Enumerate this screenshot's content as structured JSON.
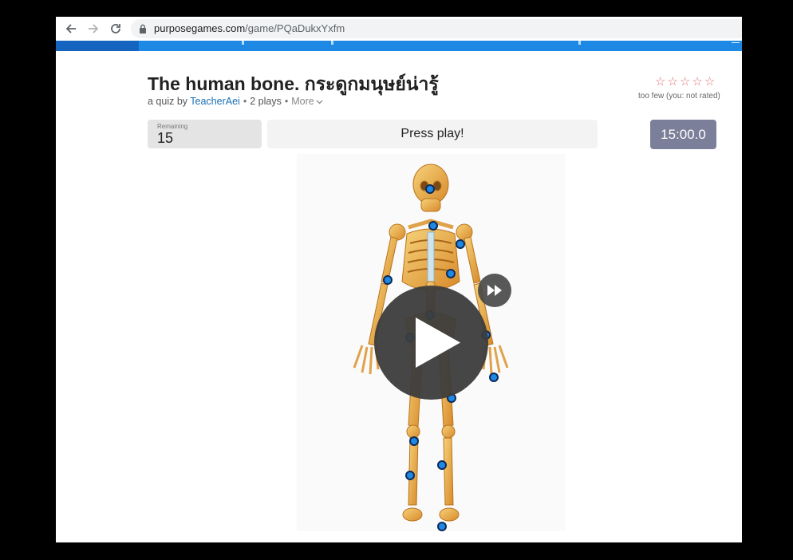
{
  "browser": {
    "url_host": "purposegames.com",
    "url_path": "/game/PQaDukxYxfm"
  },
  "quiz": {
    "title": "The human bone. กระดูกมนุษย์น่ารู้",
    "byline_prefix": "a quiz by",
    "author": "TeacherAei",
    "plays": "2 plays",
    "more": "More"
  },
  "rating": {
    "stars_filled": 0,
    "stars_total": 5,
    "note": "too few (you: not rated)"
  },
  "game": {
    "remaining_label": "Remaining",
    "remaining_value": "15",
    "press_play": "Press play!",
    "timer": "15:00.0"
  },
  "colors": {
    "accent_blue": "#1e88e5",
    "timer_bg": "#7c7f99",
    "star": "#e07070",
    "link": "#1a6fb3"
  },
  "icons": [
    "back-arrow-icon",
    "forward-arrow-icon",
    "reload-icon",
    "lock-icon",
    "chevron-down-icon",
    "star-icon",
    "play-icon",
    "fast-forward-icon",
    "location-pin-icon"
  ]
}
